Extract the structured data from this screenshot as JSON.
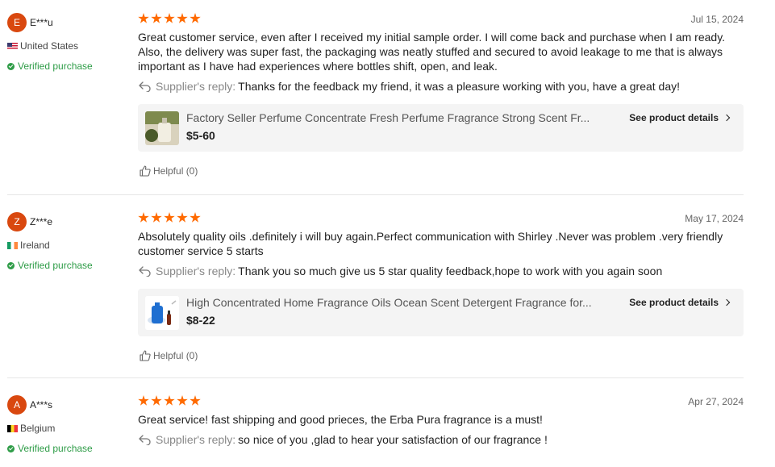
{
  "colors": {
    "star": "#ff6a00",
    "avatar": "#d9480f",
    "verified": "#2e9c47"
  },
  "reviews": [
    {
      "avatar_letter": "E",
      "name": "E***u",
      "country": "United States",
      "verified": "Verified purchase",
      "rating": 5,
      "date": "Jul 15, 2024",
      "text": "Great customer service, even after I received my initial sample order. I will come back and purchase when I am ready. Also, the delivery was super fast, the packaging was neatly stuffed and secured to avoid leakage to me that is always important as I have had experiences where bottles shift, open, and leak.",
      "reply_label": "Supplier's reply:",
      "reply_text": "Thanks for the feedback my friend, it was a pleasure working with you, have a great day!",
      "product_title": "Factory Seller Perfume Concentrate Fresh Perfume Fragrance Strong Scent Fr...",
      "product_price": "$5-60",
      "product_link": "See product details",
      "helpful": "Helpful (0)"
    },
    {
      "avatar_letter": "Z",
      "name": "Z***e",
      "country": "Ireland",
      "verified": "Verified purchase",
      "rating": 5,
      "date": "May 17, 2024",
      "text": "Absolutely quality oils .definitely i will buy again.Perfect communication with Shirley .Never was problem .very friendly customer service 5 starts",
      "reply_label": "Supplier's reply:",
      "reply_text": "Thank you so much give us 5 star quality feedback,hope to work with you again soon",
      "product_title": "High Concentrated Home Fragrance Oils Ocean Scent Detergent Fragrance for...",
      "product_price": "$8-22",
      "product_link": "See product details",
      "helpful": "Helpful (0)"
    },
    {
      "avatar_letter": "A",
      "name": "A***s",
      "country": "Belgium",
      "verified": "Verified purchase",
      "rating": 5,
      "date": "Apr 27, 2024",
      "text": "Great service! fast shipping and good prieces, the Erba Pura fragrance is a must!",
      "reply_label": "Supplier's reply:",
      "reply_text": "so nice of you ,glad to hear your satisfaction of our fragrance !"
    }
  ]
}
